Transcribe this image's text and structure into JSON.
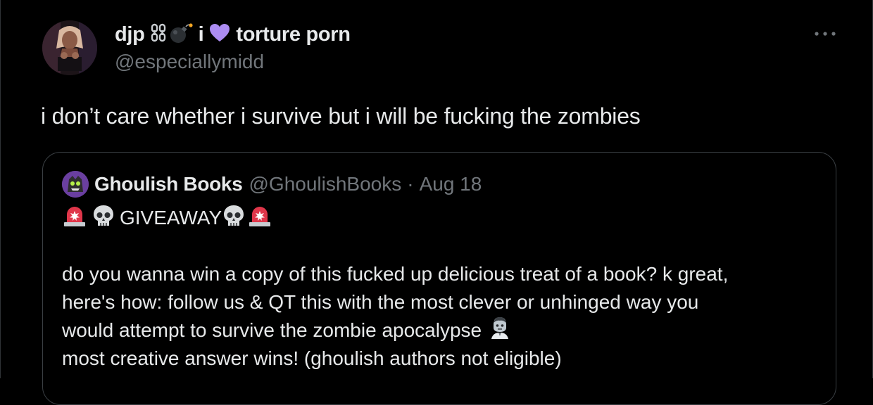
{
  "tweet": {
    "display_name_part1": "djp",
    "display_name_part2": "i",
    "display_name_part3": "torture porn",
    "handle": "@especiallymidd",
    "text": "i don’t care whether i survive but i will be fucking the zombies",
    "icons": [
      "chain-icon",
      "bomb-icon",
      "purple-heart-icon",
      "more-icon"
    ]
  },
  "quote": {
    "name": "Ghoulish Books",
    "handle": "@GhoulishBooks",
    "separator": "·",
    "date": "Aug 18",
    "headline": "GIVEAWAY",
    "body_lines": [
      "do you wanna win a copy of this fucked up delicious treat of a book? k great,",
      "here's how: follow us & QT this with the most clever or unhinged way you",
      "would attempt to survive the zombie apocalypse",
      "most creative answer wins! (ghoulish authors not eligible)"
    ],
    "icons": [
      "siren-icon",
      "skull-icon",
      "zombie-icon"
    ]
  },
  "colors": {
    "background": "#000000",
    "text": "#e7e9ea",
    "muted": "#71767b",
    "border": "#3a3f43",
    "heart": "#ac8cf2",
    "siren": "#e0364a"
  }
}
